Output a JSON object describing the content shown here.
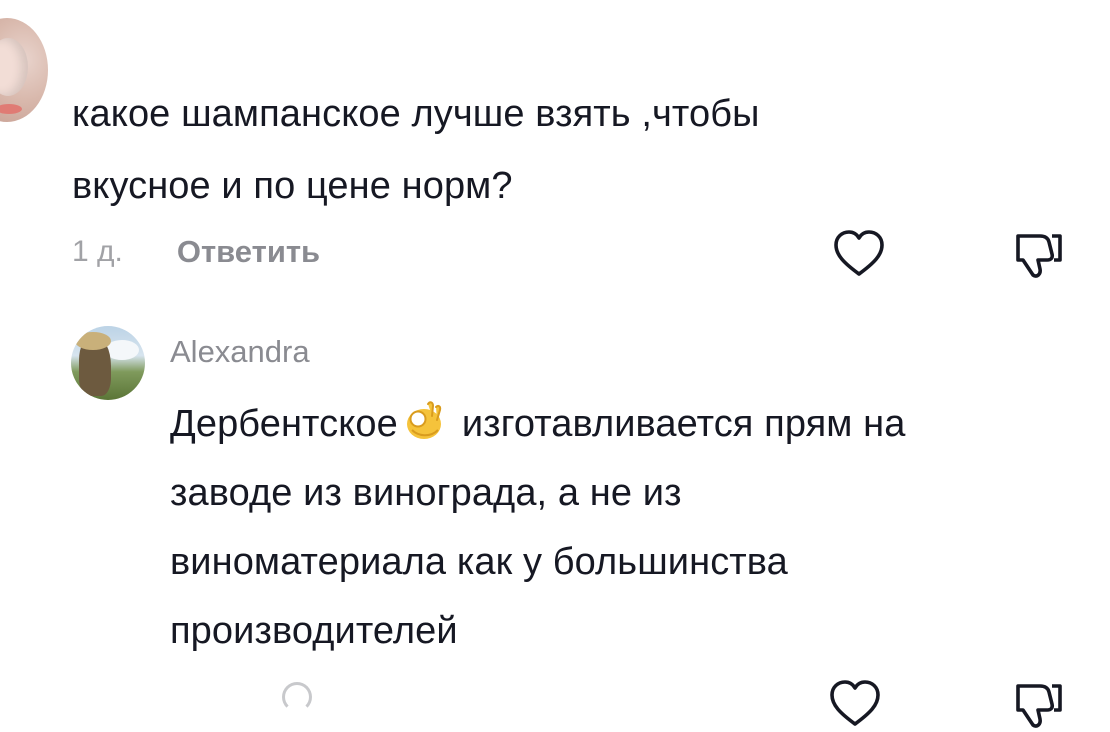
{
  "comments": [
    {
      "text_line1": "какое шампанское лучше взять ,чтобы",
      "text_line2": "вкусное и по цене норм?",
      "time": "1 д.",
      "reply_label": "Ответить",
      "icons": {
        "like": "heart-outline-icon",
        "dislike": "thumbs-down-icon"
      }
    },
    {
      "username": "Alexandra",
      "text_line1_before_emoji": "Дербентское",
      "emoji": "ok-hand-emoji",
      "text_line1_after_emoji": "изготавливается прям на",
      "text_line2": "заводе из винограда, а не из",
      "text_line3": "виноматериала как у большинства",
      "text_line4": "производителей",
      "icons": {
        "like": "heart-outline-icon",
        "dislike": "thumbs-down-icon"
      }
    }
  ],
  "colors": {
    "text": "#161823",
    "meta": "#a1a2a6",
    "secondary": "#8a8b91",
    "icon_stroke": "#161823",
    "emoji": "#f5c33b"
  }
}
